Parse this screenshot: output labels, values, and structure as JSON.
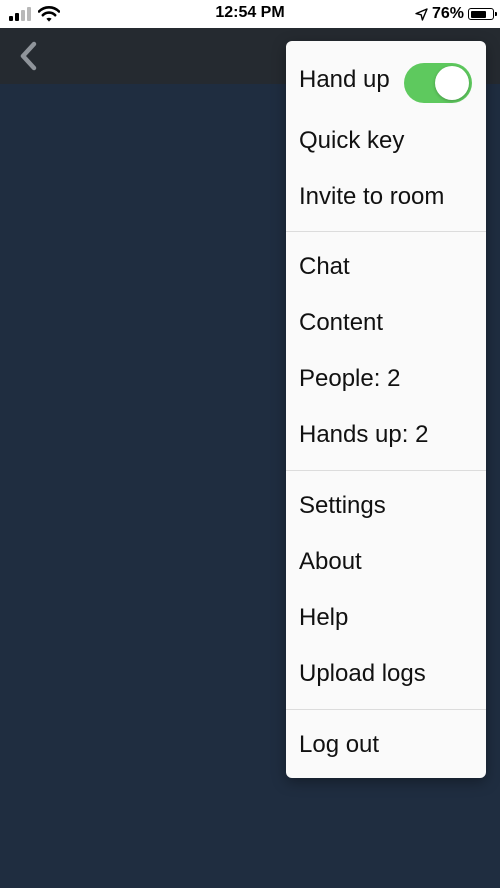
{
  "status_bar": {
    "time": "12:54 PM",
    "battery": "76%",
    "battery_level": 0.76,
    "signal_icon": "cellular-signal-icon",
    "wifi_icon": "wifi-icon",
    "location_icon": "location-arrow-icon"
  },
  "nav": {
    "back_icon": "chevron-left-icon"
  },
  "menu": {
    "hand_up": {
      "label": "Hand up",
      "toggle_on": true,
      "toggle_color": "#5ec95e"
    },
    "quick_key": "Quick key",
    "invite_to_room": "Invite to room",
    "chat": "Chat",
    "content": "Content",
    "people": "People: 2",
    "hands_up": "Hands up: 2",
    "settings": "Settings",
    "about": "About",
    "help": "Help",
    "upload_logs": "Upload logs",
    "log_out": "Log out"
  },
  "colors": {
    "background": "#1f2d40",
    "nav_bar": "#252a30",
    "menu_background": "#fafafa"
  }
}
